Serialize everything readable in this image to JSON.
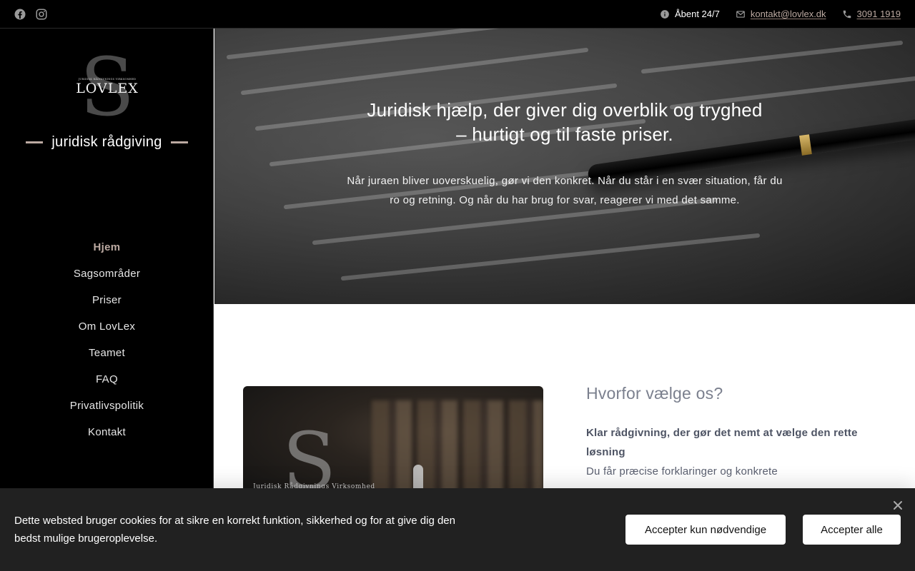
{
  "topbar": {
    "social": [
      {
        "icon": "facebook-icon"
      },
      {
        "icon": "instagram-icon"
      }
    ],
    "open_hours": "Åbent 24/7",
    "email": "kontakt@lovlex.dk",
    "phone": "3091 1919"
  },
  "brand": {
    "logo_text": "LOVLEX",
    "logo_small_text": "JURIDISK RÅDGIVNINGS VIRKSOMHED",
    "logo_letter": "S",
    "tagline": "juridisk rådgiving",
    "accent_color": "#bcaaa2"
  },
  "nav": {
    "items": [
      {
        "label": "Hjem",
        "active": true
      },
      {
        "label": "Sagsområder"
      },
      {
        "label": "Priser"
      },
      {
        "label": "Om LovLex"
      },
      {
        "label": "Teamet"
      },
      {
        "label": "FAQ"
      },
      {
        "label": "Privatlivspolitik"
      },
      {
        "label": "Kontakt"
      }
    ]
  },
  "hero": {
    "title_line1": "Juridisk hjælp, der giver dig overblik og tryghed",
    "title_line2": "– hurtigt og til faste priser.",
    "text": "Når juraen bliver uoverskuelig, gør vi den konkret. Når du står i en svær situation, får du ro og retning. Og når du har brug for svar, reagerer vi med det samme."
  },
  "content": {
    "image_caption": "Juridisk Rådgivnings Virksomhed",
    "image_letter": "S",
    "why_title": "Hvorfor vælge os?",
    "why_strong": "Klar rådgivning, der gør det nemt at vælge den rette løsning",
    "why_text": "Du får præcise forklaringer og konkrete"
  },
  "cookie": {
    "message": "Dette websted bruger cookies for at sikre en korrekt funktion, sikkerhed og for at give dig den bedst mulige brugeroplevelse.",
    "btn_necessary": "Accepter kun nødvendige",
    "btn_all": "Accepter alle",
    "close_icon": "close-icon"
  }
}
